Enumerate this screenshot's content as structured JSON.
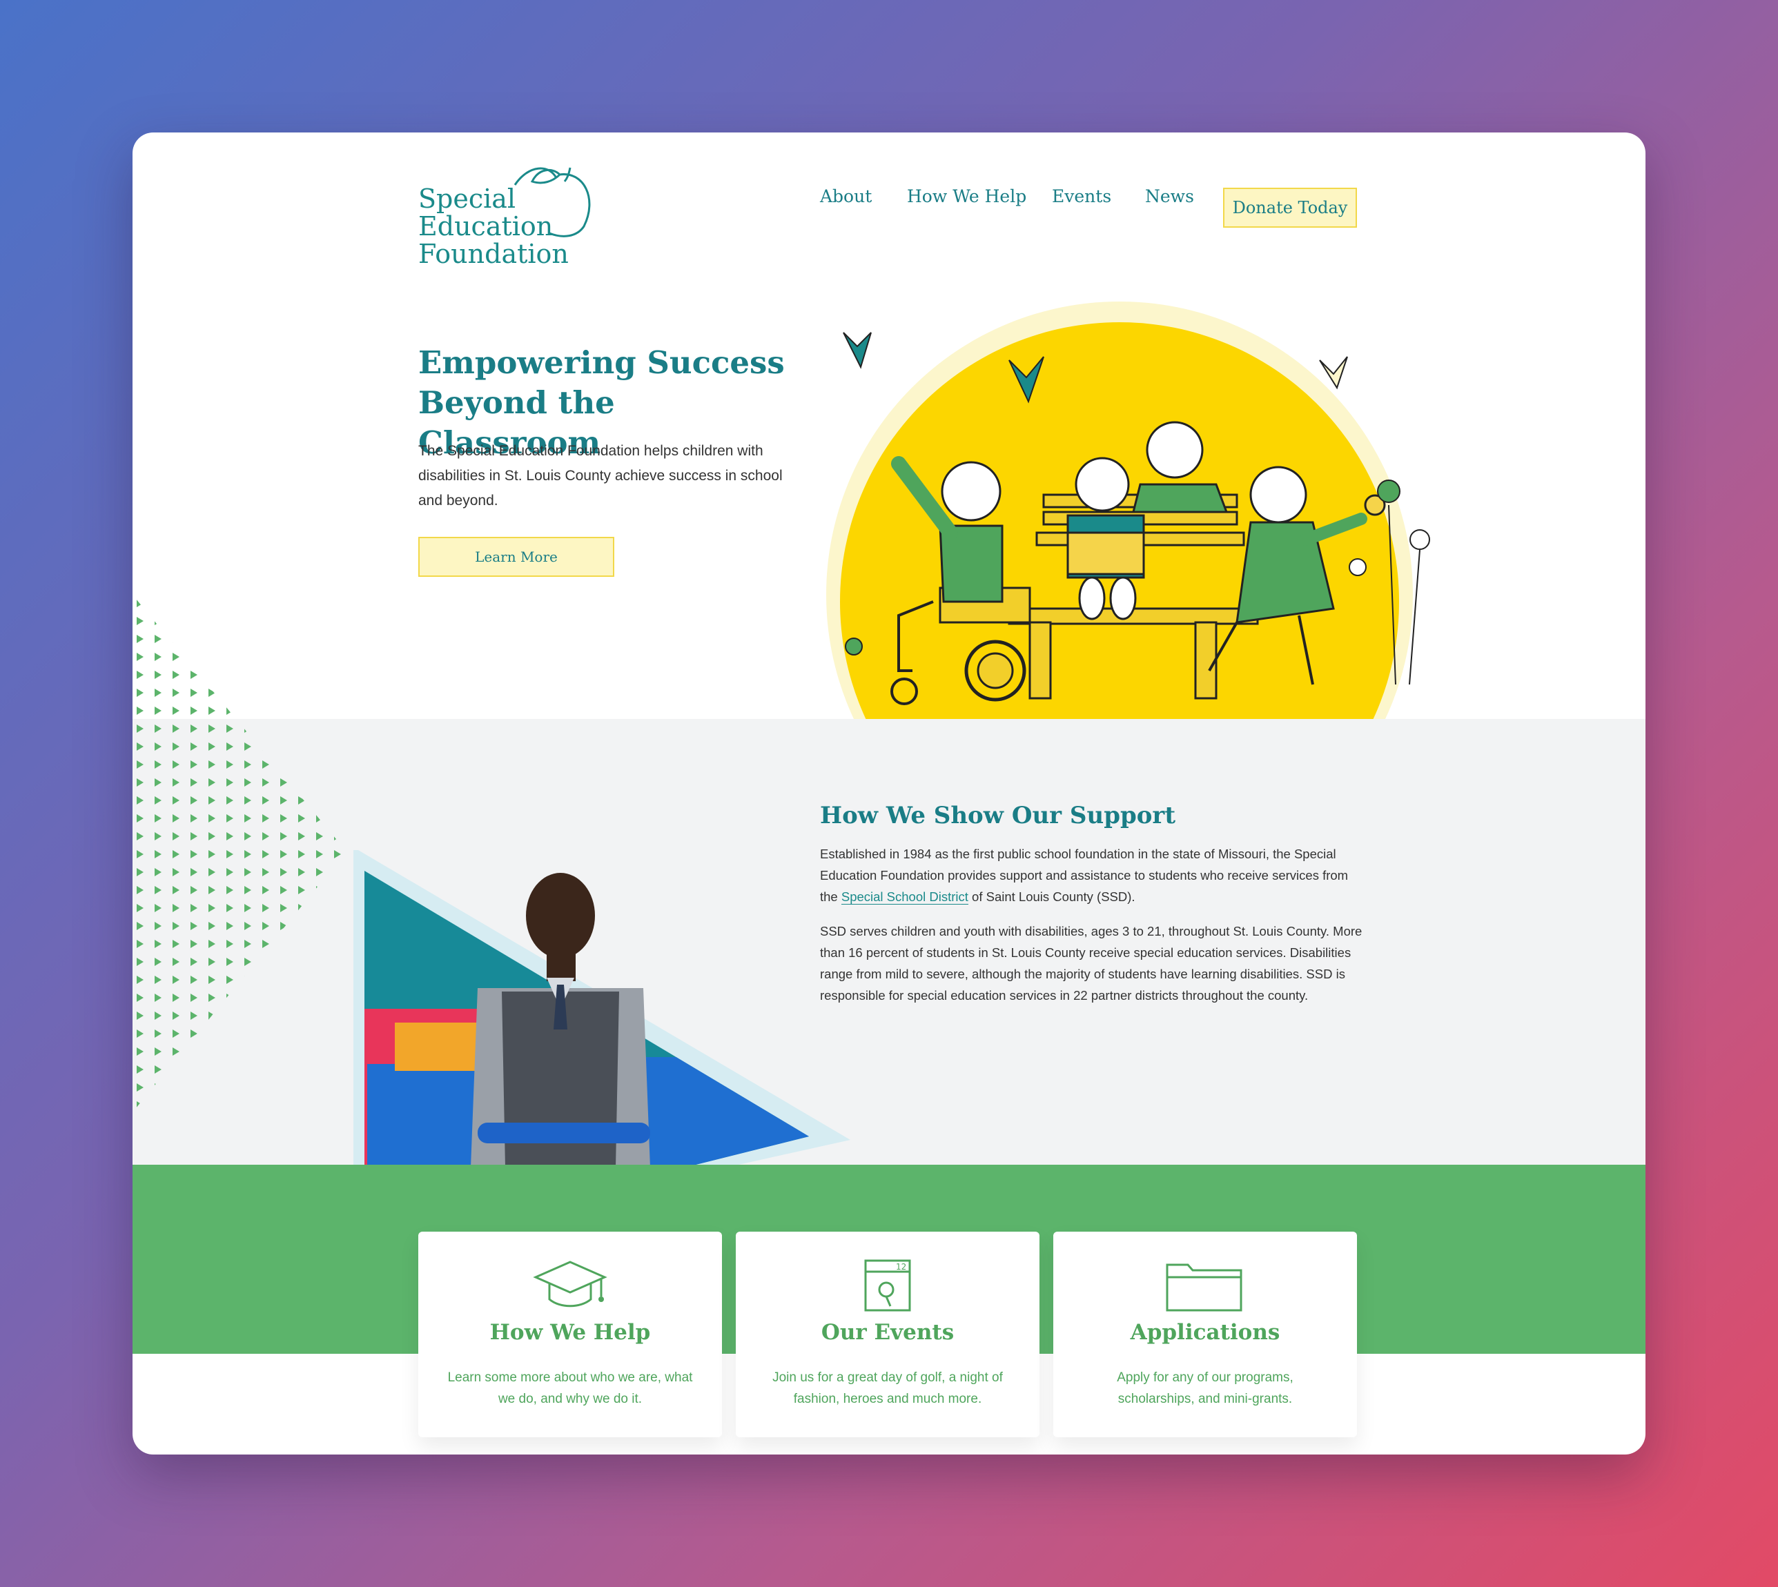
{
  "brand": {
    "line1": "Special",
    "line2": "Education",
    "line3": "Foundation"
  },
  "nav": {
    "about": "About",
    "how_we_help": "How We Help",
    "events": "Events",
    "news": "News",
    "donate": "Donate Today"
  },
  "hero": {
    "title_line1": "Empowering Success",
    "title_line2": "Beyond the Classroom",
    "description": "The Special Education Foundation helps children with disabilities in St. Louis County achieve success in school and beyond.",
    "cta": "Learn More"
  },
  "support": {
    "title": "How We Show Our Support",
    "p1_before": "Established in 1984 as the first public school foundation in the state of Missouri, the Special Education Foundation provides support and assistance to students who receive services from the ",
    "p1_link": "Special School District",
    "p1_after": " of Saint Louis County (SSD).",
    "p2": "SSD serves children and youth with disabilities, ages 3 to 21, throughout St. Louis County. More than 16 percent of students in St. Louis County receive special education services. Disabilities range from mild to severe, although the majority of students have learning disabilities. SSD is responsible for special education services in 22 partner districts throughout the county."
  },
  "cards": [
    {
      "title": "How We Help",
      "description": "Learn some more about who we are, what we do, and why we do it.",
      "icon": "graduation-cap-icon"
    },
    {
      "title": "Our Events",
      "description": "Join us for a great day of golf, a night of fashion, heroes and much more.",
      "icon": "calendar-icon"
    },
    {
      "title": "Applications",
      "description": "Apply for any of our programs, scholarships, and mini-grants.",
      "icon": "folder-icon"
    }
  ],
  "colors": {
    "teal": "#1a7d86",
    "green": "#5cb46b",
    "yellow": "#fcd600",
    "cream": "#fdf6c3"
  }
}
